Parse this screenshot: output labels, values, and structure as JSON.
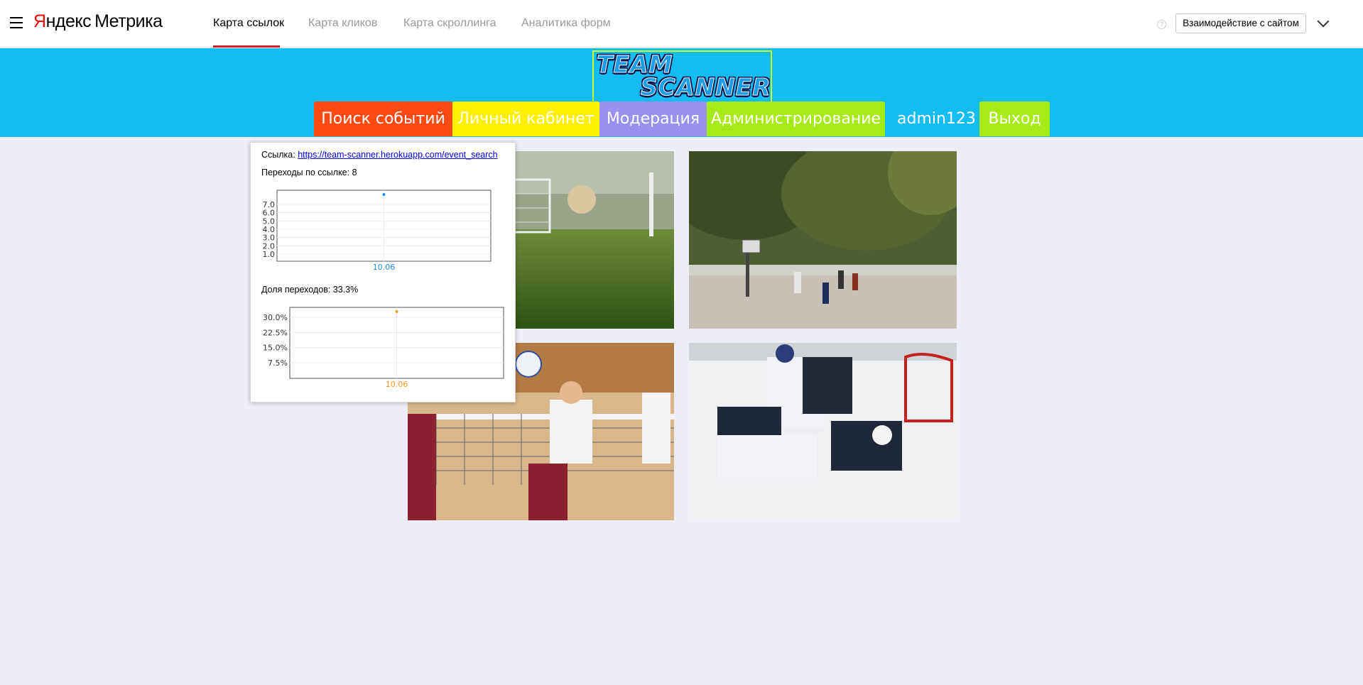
{
  "metrika": {
    "logo_ya_red": "Я",
    "logo_ya_rest": "ндекс",
    "logo_product": "Метрика",
    "tabs": [
      {
        "label": "Карта ссылок",
        "active": true
      },
      {
        "label": "Карта кликов",
        "active": false
      },
      {
        "label": "Карта скроллинга",
        "active": false
      },
      {
        "label": "Аналитика форм",
        "active": false
      }
    ],
    "help_icon_glyph": "?",
    "interaction_button": "Взаимодействие с сайтом"
  },
  "site": {
    "logo_line1": "TEAM",
    "logo_line2": "SCANNER",
    "nav": [
      {
        "label": "Поиск событий",
        "color": "#ff4a12"
      },
      {
        "label": "Личный кабинет",
        "color": "#fff000"
      },
      {
        "label": "Модерация",
        "color": "#9b8ff0"
      },
      {
        "label": "Администрирование",
        "color": "#a6ea17"
      }
    ],
    "username": "admin123",
    "logout": {
      "label": "Выход",
      "color": "#a6ea17"
    },
    "header_color": "#15bcf0",
    "page_background": "#eeeef8"
  },
  "photos": [
    {
      "name": "soccer-photo"
    },
    {
      "name": "basketball-photo"
    },
    {
      "name": "volleyball-photo"
    },
    {
      "name": "hockey-photo"
    }
  ],
  "tooltip": {
    "link_label": "Ссылка:",
    "link_url": "https://team-scanner.herokuapp.com/event_search",
    "clicks_label": "Переходы по ссылке: 8",
    "share_label": "Доля переходов: 33.3%"
  },
  "chart_data": [
    {
      "type": "scatter",
      "categories": [
        "10.06"
      ],
      "series": [
        {
          "values": [
            8
          ],
          "color": "#1c8ef0"
        }
      ],
      "yticks": [
        "7.0",
        "6.0",
        "5.0",
        "4.0",
        "3.0",
        "2.0",
        "1.0"
      ],
      "ylim": [
        0,
        8
      ]
    },
    {
      "type": "scatter",
      "categories": [
        "10.06"
      ],
      "series": [
        {
          "values": [
            33.3
          ],
          "color": "#f29b1d"
        }
      ],
      "yticks": [
        "30.0%",
        "22.5%",
        "15.0%",
        "7.5%"
      ],
      "ylim": [
        0,
        33.3
      ]
    }
  ]
}
